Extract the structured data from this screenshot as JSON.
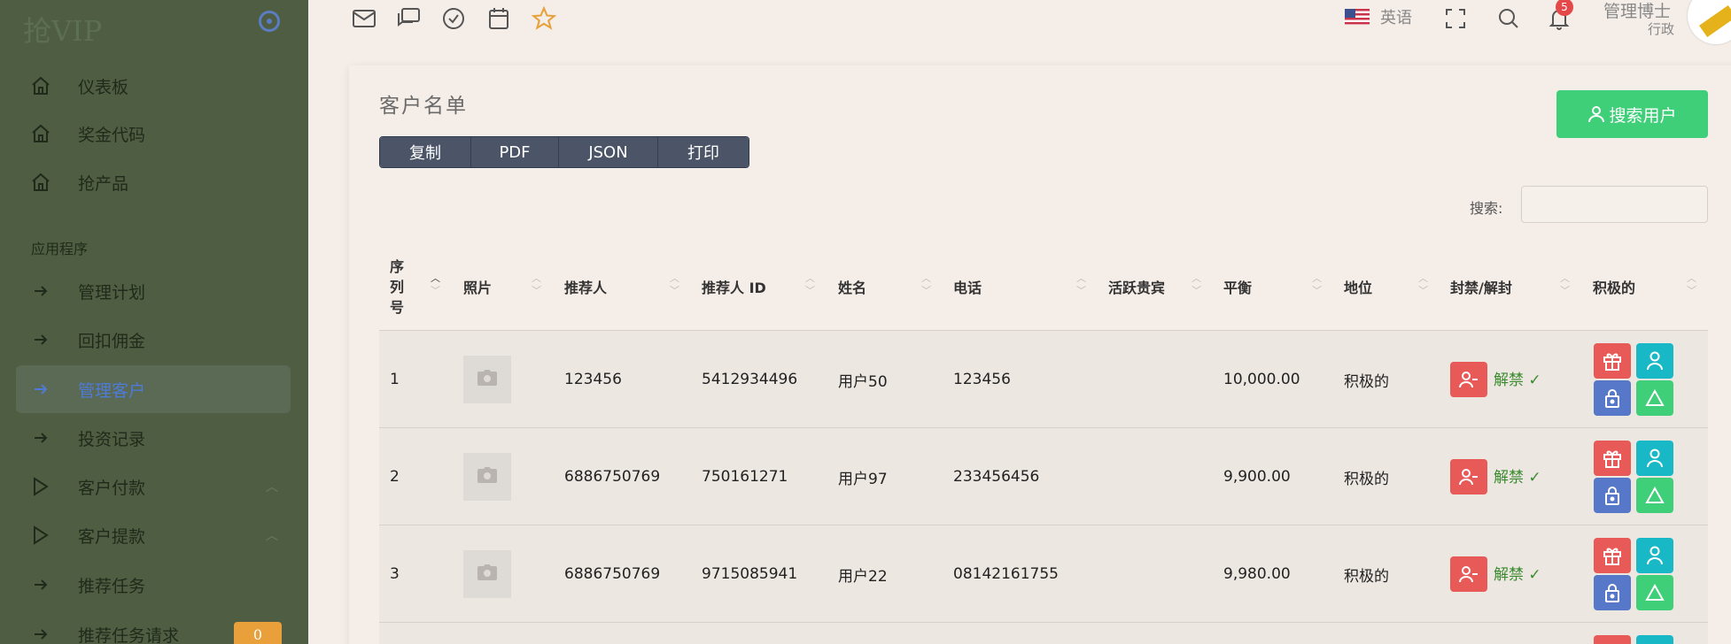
{
  "sidebar": {
    "brand": "抢VIP",
    "items_top": [
      {
        "label": "仪表板",
        "icon": "home-icon"
      },
      {
        "label": "奖金代码",
        "icon": "home-icon"
      },
      {
        "label": "抢产品",
        "icon": "home-icon"
      }
    ],
    "section_title": "应用程序",
    "items_app": [
      {
        "label": "管理计划",
        "icon": "arrow-right-icon"
      },
      {
        "label": "回扣佣金",
        "icon": "arrow-right-icon"
      },
      {
        "label": "管理客户",
        "icon": "arrow-right-icon",
        "active": true
      },
      {
        "label": "投资记录",
        "icon": "arrow-right-icon"
      },
      {
        "label": "客户付款",
        "icon": "play-icon",
        "expandable": true
      },
      {
        "label": "客户提款",
        "icon": "play-icon",
        "expandable": true
      },
      {
        "label": "推荐任务",
        "icon": "arrow-right-icon"
      },
      {
        "label": "推荐任务请求",
        "icon": "arrow-right-icon",
        "badge": "0"
      }
    ]
  },
  "topbar": {
    "icons": [
      "mail-icon",
      "chat-icon",
      "check-circle-icon",
      "calendar-icon",
      "star-icon"
    ],
    "language": "英语",
    "notification_count": "5",
    "user_name": "管理博士",
    "user_role": "行政"
  },
  "card": {
    "title": "客户名单",
    "export_buttons": [
      "复制",
      "PDF",
      "JSON",
      "打印"
    ],
    "search_user_button": "搜索用户",
    "search_label": "搜索:",
    "search_value": ""
  },
  "table": {
    "columns": [
      "序列号",
      "照片",
      "推荐人",
      "推荐人 ID",
      "姓名",
      "电话",
      "活跃贵宾",
      "平衡",
      "地位",
      "封禁/解封",
      "积极的"
    ],
    "rows": [
      {
        "seq": "1",
        "referrer": "123456",
        "referrer_id": "5412934496",
        "name": "用户50",
        "phone": "123456",
        "vip": "",
        "balance": "10,000.00",
        "status": "积极的",
        "ban_label": "解禁 ✓"
      },
      {
        "seq": "2",
        "referrer": "6886750769",
        "referrer_id": "750161271",
        "name": "用户97",
        "phone": "233456456",
        "vip": "",
        "balance": "9,900.00",
        "status": "积极的",
        "ban_label": "解禁 ✓"
      },
      {
        "seq": "3",
        "referrer": "6886750769",
        "referrer_id": "9715085941",
        "name": "用户22",
        "phone": "08142161755",
        "vip": "",
        "balance": "9,980.00",
        "status": "积极的",
        "ban_label": "解禁 ✓"
      }
    ]
  },
  "colors": {
    "sidebar_bg": "#4f5e43",
    "accent_blue": "#4d7bd6",
    "green_button": "#3ecf78",
    "red_button": "#e85a58",
    "teal_button": "#18b8c6",
    "blue_button": "#5777c9",
    "badge_orange": "#e9a03b"
  }
}
